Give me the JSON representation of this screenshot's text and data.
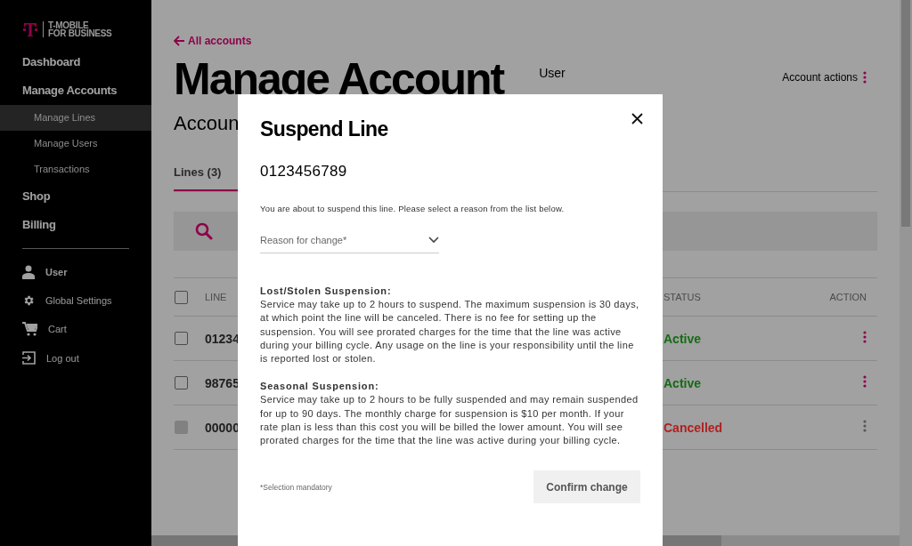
{
  "sidebar": {
    "logo": {
      "line1": "T-MOBILE",
      "line2": "FOR BUSINESS"
    },
    "nav": [
      {
        "label": "Dashboard",
        "kind": "section",
        "selected": false
      },
      {
        "label": "Manage Accounts",
        "kind": "section",
        "selected": false
      },
      {
        "label": "Manage Lines",
        "kind": "sub",
        "selected": true
      },
      {
        "label": "Manage Users",
        "kind": "sub",
        "selected": false
      },
      {
        "label": "Transactions",
        "kind": "sub",
        "selected": false
      },
      {
        "label": "Shop",
        "kind": "section",
        "selected": false
      },
      {
        "label": "Billing",
        "kind": "section",
        "selected": false
      }
    ],
    "user_menu": [
      {
        "label": "User",
        "selected": true
      },
      {
        "label": "Global Settings",
        "selected": false
      },
      {
        "label": "Cart",
        "selected": false
      },
      {
        "label": "Log out",
        "selected": false
      }
    ]
  },
  "page": {
    "back_link": "All accounts",
    "title": "Manage Account",
    "user_label": "User",
    "subtitle": "Accoun",
    "account_actions": "Account actions",
    "tabs": [
      {
        "label": "Lines (3)",
        "selected": true
      }
    ],
    "table": {
      "columns": [
        "LINE",
        "STATUS",
        "ACTION"
      ],
      "header_checked": false,
      "rows": [
        {
          "line": "01234",
          "status": "Active",
          "color": "#166b16",
          "checked": false,
          "disabled": false
        },
        {
          "line": "98765",
          "status": "Active",
          "color": "#166b16",
          "checked": false,
          "disabled": false
        },
        {
          "line": "00000",
          "status": "Cancelled",
          "color": "#b02020",
          "checked": false,
          "disabled": true
        }
      ]
    }
  },
  "modal": {
    "title": "Suspend Line",
    "line_number": "0123456789",
    "description": "You are about to suspend this line. Please select a reason from the list below.",
    "reason_field": {
      "placeholder": "Reason for change*"
    },
    "sections": [
      {
        "heading": "Lost/Stolen Suspension:",
        "body": "Service may take up to 2 hours to suspend. The maximum suspension is 30 days, at which point the line will be canceled. There is no fee for setting up the suspension. You will see prorated charges for the time that the line was active during your billing cycle. Any usage on the line is your responsibility until the line is reported lost or stolen."
      },
      {
        "heading": "Seasonal Suspension:",
        "body": "Service may take up to 2 hours to be fully suspended and may remain suspended for up to 90 days. The monthly charge for suspension is $10 per month. If your rate plan is less than this cost you will be billed the lower amount. You will see prorated charges for the time that the line was active during your billing cycle."
      }
    ],
    "footnote": "*Selection mandatory",
    "confirm_button": "Confirm change"
  }
}
